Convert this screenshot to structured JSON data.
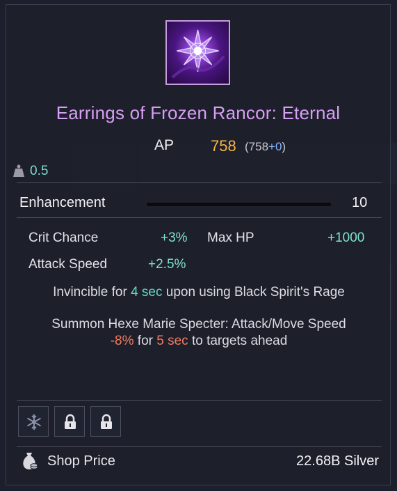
{
  "item": {
    "name": "Earrings of Frozen Rancor: Eternal",
    "ap_label": "AP",
    "ap_value": "758",
    "ap_base": "(758",
    "ap_bonus": "+0",
    "ap_close": ")",
    "weight": "0.5"
  },
  "enhancement": {
    "label": "Enhancement",
    "value": "10",
    "progress": 1.0
  },
  "stats": [
    {
      "label": "Crit Chance",
      "value": "+3%"
    },
    {
      "label": "Max HP",
      "value": "+1000"
    },
    {
      "label": "Attack Speed",
      "value": "+2.5%"
    }
  ],
  "effects": {
    "invincible": {
      "pre": "Invincible for ",
      "duration": "4 sec",
      "post": " upon using Black Spirit's Rage"
    },
    "summon": {
      "line1": "Summon Hexe Marie Specter: Attack/Move Speed",
      "amount": "-8%",
      "mid": " for ",
      "duration": "5 sec",
      "post": " to targets ahead"
    }
  },
  "slots": [
    {
      "icon": "snowflake-crystal-icon",
      "state": "filled"
    },
    {
      "icon": "lock-icon",
      "state": "locked"
    },
    {
      "icon": "lock-icon",
      "state": "locked"
    }
  ],
  "price": {
    "label": "Shop Price",
    "value": "22.68B Silver"
  },
  "colors": {
    "title": "#d79ff4",
    "ap_value": "#f5b54a",
    "stat_value": "#7fe3cf",
    "debuff": "#f07a62",
    "icon_border": "#c79be0"
  }
}
